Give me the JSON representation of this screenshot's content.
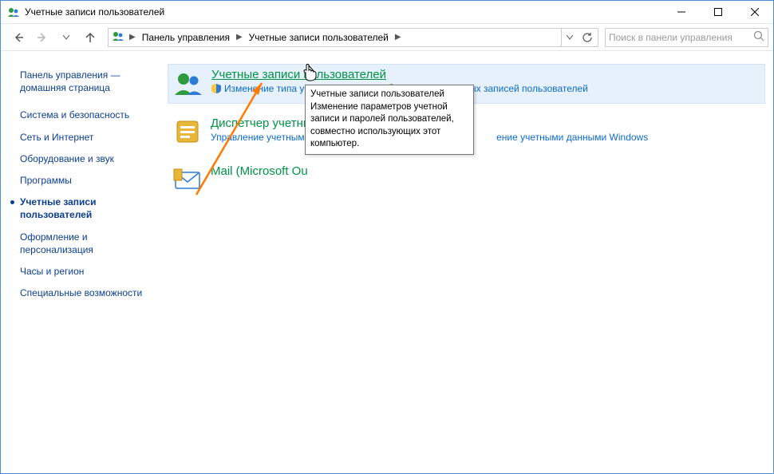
{
  "window": {
    "title": "Учетные записи пользователей"
  },
  "breadcrumb": {
    "item1": "Панель управления",
    "item2": "Учетные записи пользователей"
  },
  "search": {
    "placeholder": "Поиск в панели управления"
  },
  "sidebar": {
    "home": "Панель управления — домашняя страница",
    "items": [
      "Система и безопасность",
      "Сеть и Интернет",
      "Оборудование и звук",
      "Программы"
    ],
    "active": "Учетные записи пользователей",
    "items2": [
      "Оформление и персонализация",
      "Часы и регион",
      "Специальные возможности"
    ]
  },
  "main": {
    "cat1": {
      "title": "Учетные записи пользователей",
      "sub1": "Изменение типа учетной записи",
      "sub2": "Удаление учетных записей пользователей"
    },
    "cat2": {
      "title": "Диспетчер учетнь",
      "sub1_a": "Управление учетными данными",
      "sub1_b": "ение учетными данными Windows"
    },
    "cat3": {
      "title": "Mail (Microsoft Ou"
    }
  },
  "tooltip": {
    "title": "Учетные записи пользователей",
    "body": "Изменение параметров учетной записи и паролей пользователей, совместно использующих этот компьютер."
  }
}
